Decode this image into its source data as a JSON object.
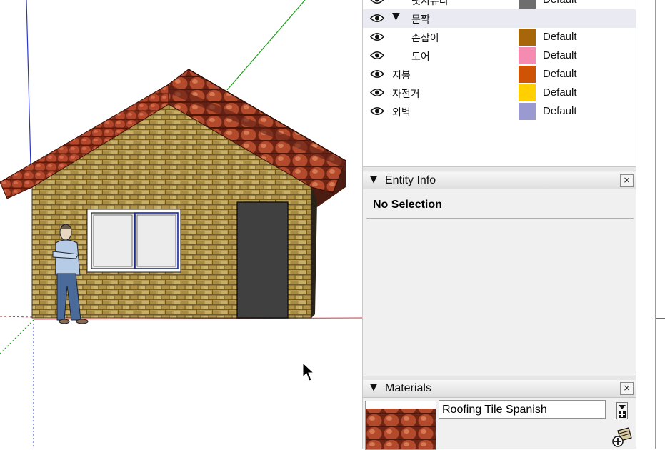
{
  "tags_panel": {
    "rows": [
      {
        "name": "핏지뮤디",
        "color": "#6e6e6e",
        "line": "Default",
        "indent": true,
        "expandable": false,
        "selected": false
      },
      {
        "name": "문짝",
        "color": null,
        "line": "",
        "indent": false,
        "expandable": true,
        "selected": true
      },
      {
        "name": "손잡이",
        "color": "#a8660a",
        "line": "Default",
        "indent": true,
        "expandable": false,
        "selected": false
      },
      {
        "name": "도어",
        "color": "#f48bb0",
        "line": "Default",
        "indent": true,
        "expandable": false,
        "selected": false
      },
      {
        "name": "지붕",
        "color": "#cf5304",
        "line": "Default",
        "indent": false,
        "expandable": false,
        "selected": false
      },
      {
        "name": "자전거",
        "color": "#ffcf00",
        "line": "Default",
        "indent": false,
        "expandable": false,
        "selected": false
      },
      {
        "name": "외벽",
        "color": "#9a9ad0",
        "line": "Default",
        "indent": false,
        "expandable": false,
        "selected": false
      }
    ],
    "expand_glyph": "▼"
  },
  "entity_info": {
    "title": "Entity Info",
    "collapse_glyph": "▼",
    "close_glyph": "×",
    "selection_text": "No Selection"
  },
  "materials": {
    "title": "Materials",
    "collapse_glyph": "▼",
    "close_glyph": "×",
    "material_name": "Roofing Tile Spanish",
    "icons": [
      "details-menu-icon",
      "create-material-icon"
    ]
  },
  "viewport": {
    "axis_colors": {
      "blue": "#2b35c8",
      "green": "#1a9e1a",
      "red": "#c43a3a"
    },
    "cursor_icon": "arrow-cursor-icon"
  }
}
